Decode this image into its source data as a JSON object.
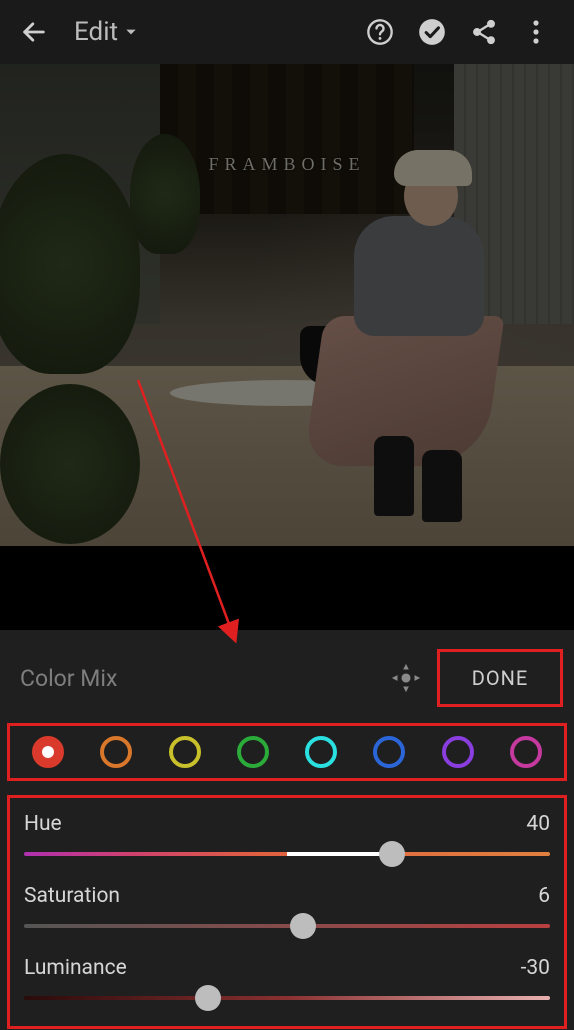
{
  "header": {
    "title": "Edit",
    "sign_text": "FRAMBOISE"
  },
  "panel": {
    "title": "Color Mix",
    "done_label": "DONE"
  },
  "swatches": [
    {
      "name": "red",
      "color": "#d93a2b",
      "active": true
    },
    {
      "name": "orange",
      "color": "#d9772b",
      "active": false
    },
    {
      "name": "yellow",
      "color": "#c9c12b",
      "active": false
    },
    {
      "name": "green",
      "color": "#2bab3a",
      "active": false
    },
    {
      "name": "aqua",
      "color": "#2be0e0",
      "active": false
    },
    {
      "name": "blue",
      "color": "#2b66d9",
      "active": false
    },
    {
      "name": "purple",
      "color": "#8a3ee0",
      "active": false
    },
    {
      "name": "magenta",
      "color": "#c63aa0",
      "active": false
    }
  ],
  "sliders": {
    "hue": {
      "label": "Hue",
      "value": 40,
      "min": -100,
      "max": 100
    },
    "saturation": {
      "label": "Saturation",
      "value": 6,
      "min": -100,
      "max": 100
    },
    "luminance": {
      "label": "Luminance",
      "value": -30,
      "min": -100,
      "max": 100
    }
  }
}
